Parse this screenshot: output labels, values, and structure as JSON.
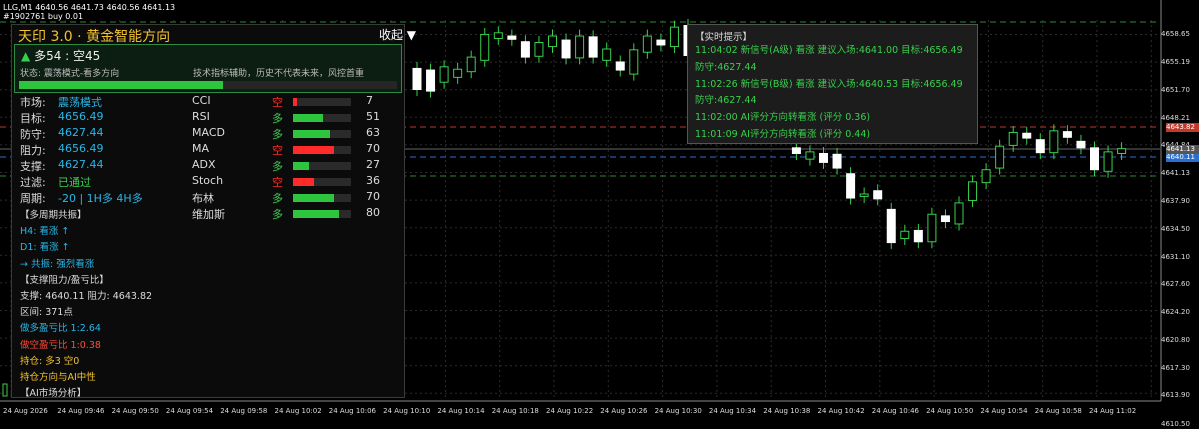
{
  "symbol_line1": "LLG,M1  4640.56 4641.73 4640.56 4641.13",
  "symbol_line2": "#1902761 buy 0.01",
  "panel": {
    "title": "天印 3.0 · 黄金智能方向",
    "collapse_label": "收起 ▼",
    "score_icon": "▲",
    "score_text": "多54 : 空45",
    "state_text": "状态: 震荡模式-看多方向",
    "disclaimer": "技术指标辅助，历史不代表未来，风控首重",
    "progress": 0.54,
    "rows": [
      {
        "key": "市场:",
        "val": "震荡模式",
        "vc": "#29b6e8",
        "ind": "CCI",
        "dir": "空",
        "dc": "#ff2a2a",
        "fill": 0.07,
        "fc": "#ff2a2a",
        "score": "7"
      },
      {
        "key": "目标:",
        "val": "4656.49",
        "vc": "#29b6e8",
        "ind": "RSI",
        "dir": "多",
        "dc": "#3ad14d",
        "fill": 0.51,
        "fc": "#2fc43e",
        "score": "51"
      },
      {
        "key": "防守:",
        "val": "4627.44",
        "vc": "#29b6e8",
        "ind": "MACD",
        "dir": "多",
        "dc": "#3ad14d",
        "fill": 0.63,
        "fc": "#2fc43e",
        "score": "63"
      },
      {
        "key": "阻力:",
        "val": "4656.49",
        "vc": "#29b6e8",
        "ind": "MA",
        "dir": "空",
        "dc": "#ff2a2a",
        "fill": 0.7,
        "fc": "#ff2a2a",
        "score": "70"
      },
      {
        "key": "支撑:",
        "val": "4627.44",
        "vc": "#29b6e8",
        "ind": "ADX",
        "dir": "多",
        "dc": "#3ad14d",
        "fill": 0.27,
        "fc": "#2fc43e",
        "score": "27"
      },
      {
        "key": "过滤:",
        "val": "已通过",
        "vc": "#3ad14d",
        "ind": "Stoch",
        "dir": "空",
        "dc": "#ff2a2a",
        "fill": 0.36,
        "fc": "#ff2a2a",
        "score": "36"
      },
      {
        "key": "周期:",
        "val": "-20 | 1H多 4H多",
        "vc": "#29b6e8",
        "ind": "布林",
        "dir": "多",
        "dc": "#3ad14d",
        "fill": 0.7,
        "fc": "#2fc43e",
        "score": "70"
      },
      {
        "key": "",
        "val": "",
        "vc": "#29b6e8",
        "ind": "维加斯",
        "dir": "多",
        "dc": "#3ad14d",
        "fill": 0.8,
        "fc": "#2fc43e",
        "score": "80"
      }
    ],
    "lines": [
      {
        "t": "【多周期共振】",
        "c": "#ddd"
      },
      {
        "t": "H4: 看涨 ↑",
        "c": "#29b6e8"
      },
      {
        "t": "D1: 看涨 ↑",
        "c": "#29b6e8"
      },
      {
        "t": "→ 共振: 强烈看涨",
        "c": "#29b6e8"
      },
      {
        "t": "【支撑阻力/盈亏比】",
        "c": "#ddd"
      },
      {
        "t": "支撑: 4640.11 阻力: 4643.82",
        "c": "#ddd"
      },
      {
        "t": "区间: 371点",
        "c": "#ddd"
      },
      {
        "t": "做多盈亏比 1:2.64",
        "c": "#29b6e8"
      },
      {
        "t": "做空盈亏比 1:0.38",
        "c": "#ff4a3a"
      },
      {
        "t": "持仓: 多3 空0",
        "c": "#f2c230"
      },
      {
        "t": "持仓方向与AI中性",
        "c": "#f2c230"
      },
      {
        "t": "【AI市场分析】",
        "c": "#ddd"
      }
    ]
  },
  "hint": {
    "title": "【实时提示】",
    "lines": [
      "11:04:02 新信号(A级) 看涨 建议入场:4641.00 目标:4656.49",
      "防守:4627.44",
      "11:02:26 新信号(B级) 看涨 建议入场:4640.53 目标:4656.49",
      "防守:4627.44",
      "11:02:00 AI评分方向转看涨 (评分 0.36)",
      "11:01:09 AI评分方向转看涨 (评分 0.44)"
    ]
  },
  "price_axis": [
    "4658.65",
    "4655.19",
    "4651.70",
    "4648.21",
    "4644.84",
    "4641.13",
    "4637.90",
    "4634.50",
    "4631.10",
    "4627.60",
    "4624.20",
    "4620.80",
    "4617.30",
    "4613.90",
    "4610.50"
  ],
  "tags": {
    "red": "4643.82",
    "blue": "4640.11",
    "gray": "4641.13"
  },
  "time_axis": [
    "24 Aug 2026",
    "24 Aug 09:46",
    "24 Aug 09:50",
    "24 Aug 09:54",
    "24 Aug 09:58",
    "24 Aug 10:02",
    "24 Aug 10:06",
    "24 Aug 10:10",
    "24 Aug 10:14",
    "24 Aug 10:18",
    "24 Aug 10:22",
    "24 Aug 10:26",
    "24 Aug 10:30",
    "24 Aug 10:34",
    "24 Aug 10:38",
    "24 Aug 10:42",
    "24 Aug 10:46",
    "24 Aug 10:50",
    "24 Aug 10:54",
    "24 Aug 10:58",
    "24 Aug 11:02"
  ],
  "candles": [
    [
      4651.0,
      4648.4
    ],
    [
      4650.8,
      4648.2
    ],
    [
      4649.3,
      4651.2
    ],
    [
      4649.9,
      4650.9
    ],
    [
      4650.6,
      4652.4
    ],
    [
      4652.0,
      4655.2
    ],
    [
      4654.7,
      4655.4
    ],
    [
      4655.0,
      4654.6
    ],
    [
      4654.3,
      4652.4
    ],
    [
      4652.5,
      4654.2
    ],
    [
      4653.7,
      4655.0
    ],
    [
      4654.5,
      4652.3
    ],
    [
      4652.3,
      4655.0
    ],
    [
      4654.9,
      4652.4
    ],
    [
      4652.0,
      4653.4
    ],
    [
      4651.8,
      4650.8
    ],
    [
      4650.3,
      4653.3
    ],
    [
      4653.0,
      4655.0
    ],
    [
      4654.5,
      4653.9
    ],
    [
      4653.7,
      4656.1
    ],
    [
      4656.3,
      4652.6
    ],
    [
      4652.5,
      4653.3
    ],
    [
      4653.6,
      4651.9
    ],
    [
      4651.5,
      4652.4
    ],
    [
      4652.6,
      4651.3
    ],
    [
      4651.0,
      4649.9
    ],
    [
      4650.2,
      4648.3
    ],
    [
      4646.8,
      4646.3
    ],
    [
      4641.2,
      4640.5
    ],
    [
      4639.8,
      4640.7
    ],
    [
      4640.5,
      4639.4
    ],
    [
      4640.4,
      4638.7
    ],
    [
      4638.0,
      4635.0
    ],
    [
      4635.2,
      4635.5
    ],
    [
      4635.9,
      4634.9
    ],
    [
      4633.6,
      4629.5
    ],
    [
      4630.0,
      4630.9
    ],
    [
      4631.0,
      4629.6
    ],
    [
      4629.6,
      4633.0
    ],
    [
      4632.8,
      4632.1
    ],
    [
      4631.8,
      4634.4
    ],
    [
      4634.7,
      4637.0
    ],
    [
      4636.9,
      4638.5
    ],
    [
      4638.7,
      4641.4
    ],
    [
      4641.5,
      4643.1
    ],
    [
      4643.0,
      4642.4
    ],
    [
      4642.2,
      4640.6
    ],
    [
      4640.6,
      4643.3
    ],
    [
      4643.2,
      4642.5
    ],
    [
      4642.0,
      4641.2
    ],
    [
      4641.2,
      4638.5
    ],
    [
      4638.3,
      4640.7
    ],
    [
      4640.5,
      4641.1
    ]
  ]
}
